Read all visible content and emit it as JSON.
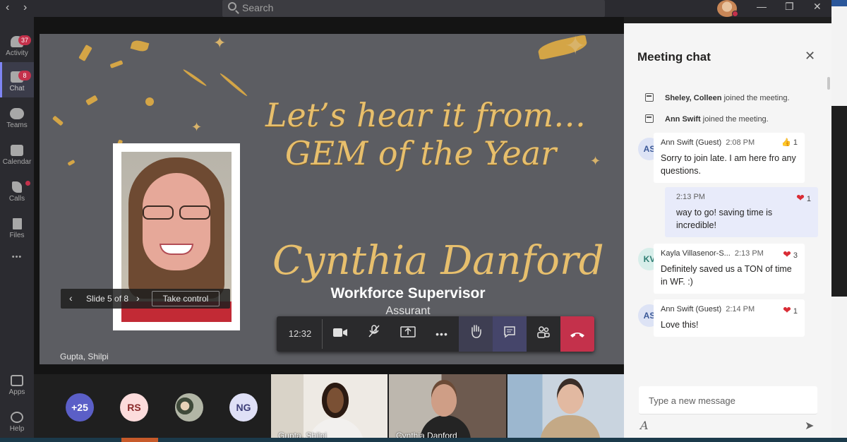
{
  "titlebar": {
    "search_placeholder": "Search",
    "back_glyph": "‹",
    "forward_glyph": "›",
    "minimize_glyph": "—",
    "maximize_glyph": "❐",
    "close_glyph": "✕"
  },
  "rail": {
    "items": [
      {
        "label": "Activity",
        "badge": "37",
        "icon": "bell-icon"
      },
      {
        "label": "Chat",
        "badge": "8",
        "icon": "chat-icon"
      },
      {
        "label": "Teams",
        "icon": "teams-icon"
      },
      {
        "label": "Calendar",
        "icon": "calendar-icon"
      },
      {
        "label": "Calls",
        "icon": "phone-icon"
      },
      {
        "label": "Files",
        "icon": "file-icon"
      },
      {
        "label": "Apps",
        "icon": "apps-icon"
      },
      {
        "label": "Help",
        "icon": "help-icon"
      }
    ],
    "more_glyph": "•••"
  },
  "slide": {
    "headline_1": "Let’s hear it from…",
    "headline_2": "GEM of the Year",
    "name": "Cynthia Danford",
    "job_title": "Workforce Supervisor",
    "company": "Assurant"
  },
  "slide_controls": {
    "prev_glyph": "‹",
    "next_glyph": "›",
    "label": "Slide 5 of 8",
    "take_control": "Take control"
  },
  "speaker_label": "Gupta, Shilpi",
  "call_bar": {
    "time": "12:32"
  },
  "participants": {
    "overflow": "+25",
    "bubbles": [
      {
        "initials": "RS",
        "bg": "#fcdcdc",
        "fg": "#8a2a2a"
      },
      {
        "initials": "NG",
        "bg": "#dfe0f6",
        "fg": "#3d3e78"
      }
    ],
    "tiles": [
      {
        "label": "Gupta, Shilpi"
      },
      {
        "label": "Cynthia Danford"
      },
      {
        "label": ""
      }
    ]
  },
  "chat": {
    "title": "Meeting chat",
    "close_glyph": "✕",
    "system": [
      {
        "names": "Sheley, Colleen",
        "text": "joined the meeting."
      },
      {
        "names": "Ann Swift",
        "text": "joined the meeting."
      }
    ],
    "messages": [
      {
        "initials": "AS",
        "author": "Ann Swift (Guest)",
        "time": "2:08 PM",
        "reaction": "👍",
        "count": "1",
        "body": "Sorry to join late. I am here fro any questions.",
        "me": false
      },
      {
        "initials": "",
        "author": "",
        "time": "2:13 PM",
        "reaction": "❤",
        "count": "1",
        "body": "way to go!  saving time is incredible!",
        "me": true
      },
      {
        "initials": "KV",
        "author": "Kayla Villasenor-S...",
        "time": "2:13 PM",
        "reaction": "❤",
        "count": "3",
        "body": "Definitely saved us a TON of time in WF. :)",
        "me": false
      },
      {
        "initials": "AS",
        "author": "Ann Swift (Guest)",
        "time": "2:14 PM",
        "reaction": "❤",
        "count": "1",
        "body": "Love this!",
        "me": false
      }
    ],
    "compose_placeholder": "Type a new message",
    "format_glyph": "A",
    "send_glyph": "➤"
  },
  "colors": {
    "accent": "#7f85f5",
    "danger": "#c4314b",
    "gold": "#e7bf6d"
  }
}
